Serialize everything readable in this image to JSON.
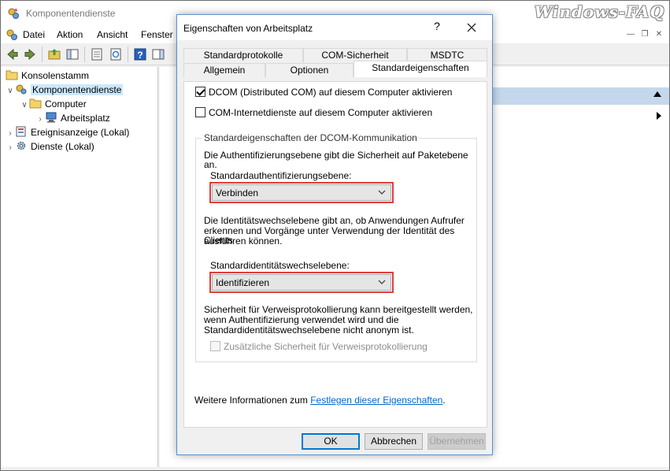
{
  "window": {
    "title": "Komponentendienste",
    "watermark": "Windows-FAQ"
  },
  "menu": [
    "Datei",
    "Aktion",
    "Ansicht",
    "Fenster"
  ],
  "tree": {
    "root": "Konsolenstamm",
    "items": [
      {
        "label": "Komponentendienste",
        "selected": true
      },
      {
        "label": "Computer"
      },
      {
        "label": "Arbeitsplatz"
      },
      {
        "label": "Ereignisanzeige (Lokal)"
      },
      {
        "label": "Dienste (Lokal)"
      }
    ]
  },
  "dialog": {
    "title": "Eigenschaften von Arbeitsplatz",
    "help_symbol": "?",
    "tabs_row1": [
      "Standardprotokolle",
      "COM-Sicherheit",
      "MSDTC"
    ],
    "tabs_row2": [
      "Allgemein",
      "Optionen",
      "Standardeigenschaften"
    ],
    "active_tab": "Standardeigenschaften",
    "checkbox_dcom": {
      "label": "DCOM (Distributed COM) auf diesem Computer aktivieren",
      "checked": true
    },
    "checkbox_internet": {
      "label": "COM-Internetdienste auf diesem Computer aktivieren",
      "checked": false
    },
    "group": {
      "legend": "Standardeigenschaften der DCOM-Kommunikation",
      "auth_desc": "Die Authentifizierungsebene gibt die Sicherheit auf Paketebene an.",
      "auth_label": "Standardauthentifizierungsebene:",
      "auth_value": "Verbinden",
      "imp_desc": [
        "Die Identitätswechselebene gibt an, ob Anwendungen Aufrufer",
        "erkennen und Vorgänge unter Verwendung der Identität des Clients",
        "ausführen können."
      ],
      "imp_label": "Standardidentitätswechselebene:",
      "imp_value": "Identifizieren",
      "ref_desc": [
        "Sicherheit für Verweisprotokollierung kann bereitgestellt werden,",
        "wenn Authentifizierung verwendet wird und die",
        "Standardidentitätswechselebene nicht anonym ist."
      ],
      "ref_checkbox": {
        "label": "Zusätzliche Sicherheit für Verweisprotokollierung",
        "checked": false,
        "disabled": true
      }
    },
    "info_prefix": "Weitere Informationen zum ",
    "info_link": "Festlegen dieser Eigenschaften",
    "info_suffix": ".",
    "buttons": {
      "ok": "OK",
      "cancel": "Abbrechen",
      "apply": "Übernehmen"
    }
  },
  "colors": {
    "accent": "#0078d7",
    "highlight_box": "#e33b3b",
    "header_bar": "#c5d7ec",
    "link": "#0066cc"
  }
}
